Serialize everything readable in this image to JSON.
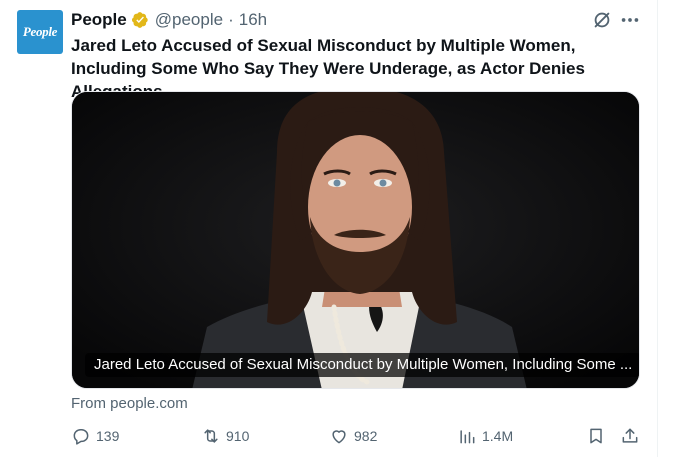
{
  "author": {
    "name": "People",
    "handle": "@people",
    "separator": "·",
    "time": "16h",
    "avatar_text": "People",
    "avatar_color": "#2a92cf",
    "verified_color": "#e2b719"
  },
  "tweet": {
    "text": "Jared Leto Accused of Sexual Misconduct by Multiple Women, Including Some Who Say They Were Underage, as Actor Denies Allegations"
  },
  "card": {
    "caption": "Jared Leto Accused of Sexual Misconduct by Multiple Women, Including Some ...",
    "source": "From people.com"
  },
  "actions": {
    "replies": "139",
    "reposts": "910",
    "likes": "982",
    "views": "1.4M"
  },
  "icons": [
    "grok-icon",
    "more-icon",
    "reply-icon",
    "repost-icon",
    "like-icon",
    "views-icon",
    "bookmark-icon",
    "share-icon",
    "verified-badge-icon"
  ]
}
